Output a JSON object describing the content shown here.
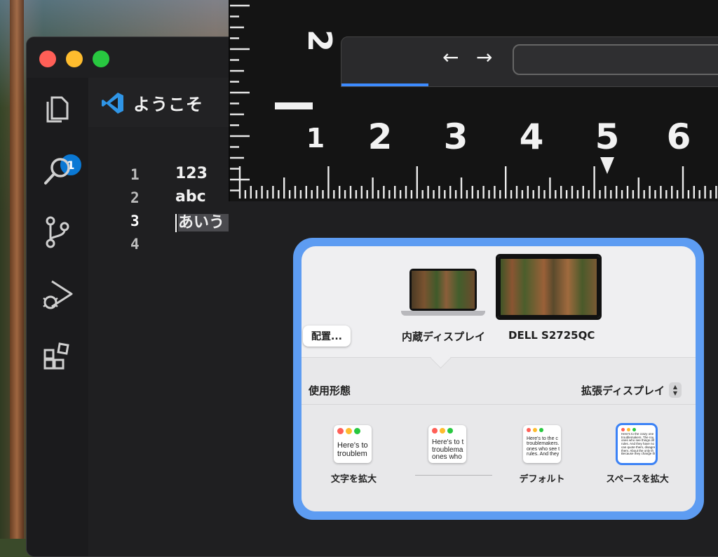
{
  "editor": {
    "tab_title": "ようこそ",
    "badge_count": "1",
    "lines": [
      {
        "number": "1",
        "text": "123"
      },
      {
        "number": "2",
        "text": "abc"
      },
      {
        "number": "3",
        "text": "あいう"
      },
      {
        "number": "4",
        "text": ""
      }
    ],
    "active_line": "3"
  },
  "ruler": {
    "small_number": "2",
    "numbers": [
      "1",
      "2",
      "3",
      "4",
      "5",
      "6"
    ]
  },
  "browser": {
    "back": "←",
    "forward": "→"
  },
  "display_panel": {
    "arrange_button": "配置...",
    "builtin_display": "内蔵ディスプレイ",
    "external_display": "DELL S2725QC",
    "usage_label": "使用形態",
    "usage_value": "拡張ディスプレイ",
    "options": [
      {
        "label": "文字を拡大",
        "preview": "Here's to\ntroublem"
      },
      {
        "label": "",
        "preview": "Here's to t\ntroublema\nones who"
      },
      {
        "label": "デフォルト",
        "preview": "Here's to the c\ntroublemakers.\nones who see t\nrules. And they"
      },
      {
        "label": "スペースを拡大",
        "preview": "Here's to the crazy one\ntroublemakers. The rou\nones who see things dif\nrules. And they have no\ncan quote them, disagre\nthem. About the only th\nBecause they change th"
      }
    ],
    "selected_option": "スペースを拡大"
  },
  "colors": {
    "accent_blue": "#0a78d4",
    "panel_highlight": "#5d9cf2",
    "close": "#ff5f57",
    "minimize": "#febc2e",
    "zoom": "#28c840"
  }
}
